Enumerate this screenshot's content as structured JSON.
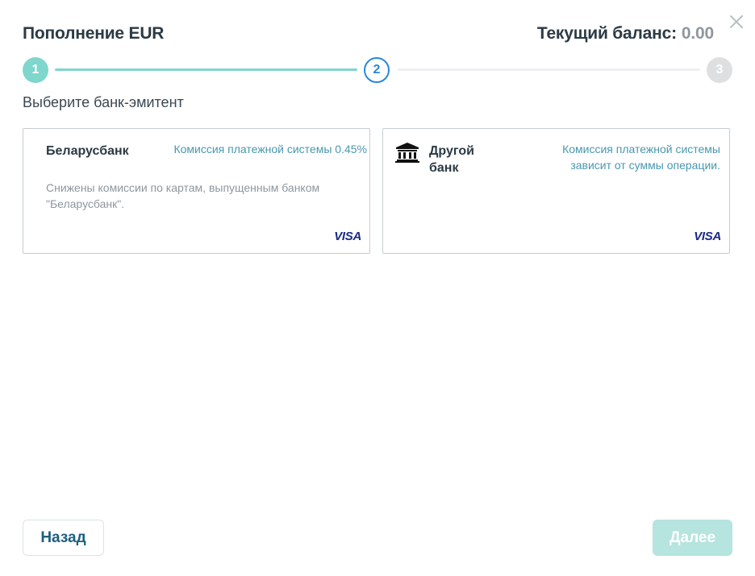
{
  "dialog": {
    "title": "Пополнение EUR",
    "balance_label": "Текущий баланс:",
    "balance_value": "0.00"
  },
  "stepper": {
    "steps": [
      {
        "label": "1",
        "state": "done"
      },
      {
        "label": "2",
        "state": "active"
      },
      {
        "label": "3",
        "state": "todo"
      }
    ]
  },
  "subtitle": "Выберите банк-эмитент",
  "banks": [
    {
      "name": "Беларусбанк",
      "fee": "Комиссия платежной системы 0.45%",
      "description": "Снижены комиссии по картам, выпущенным банком \"Беларусбанк\".",
      "payment_system": "VISA"
    },
    {
      "name": "Другой банк",
      "icon": "bank-building-icon",
      "fee": "Комиссия платежной системы зависит от суммы операции.",
      "payment_system": "VISA"
    }
  ],
  "buttons": {
    "back": "Назад",
    "next": "Далее"
  },
  "colors": {
    "accent_teal": "#7fd6cc",
    "active_blue": "#2a88d8",
    "fee_text": "#4a97ae",
    "next_disabled": "#b6e4df"
  }
}
